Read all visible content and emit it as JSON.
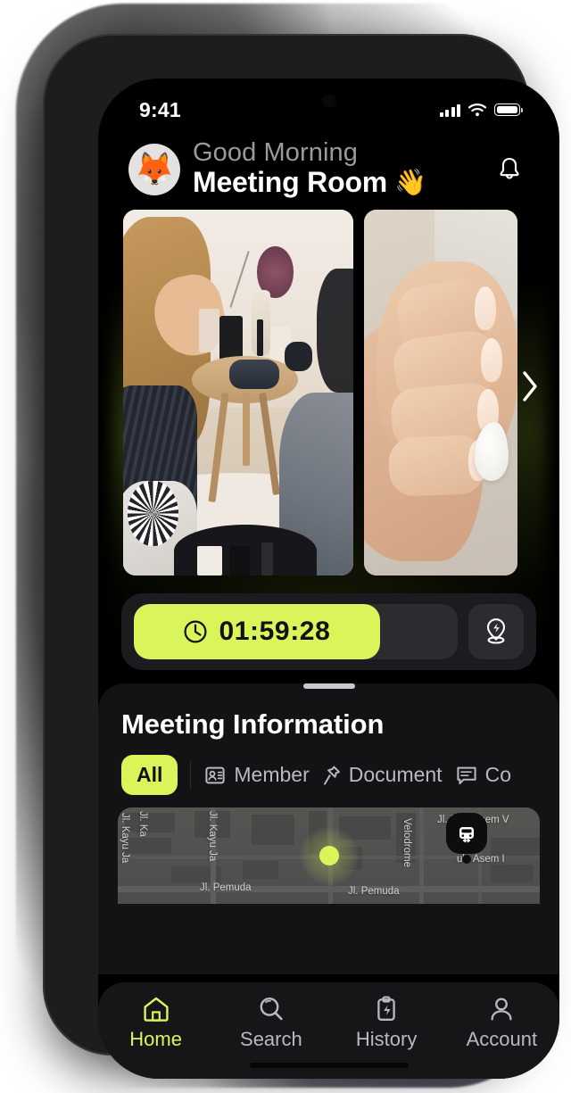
{
  "status_bar": {
    "time": "9:41",
    "signal_icon": "cellular-signal-icon",
    "wifi_icon": "wifi-icon",
    "battery_icon": "battery-icon"
  },
  "header": {
    "avatar_icon": "🦊",
    "greeting": "Good Morning",
    "title": "Meeting Room",
    "wave_emoji": "👋",
    "notification_icon": "bell-icon"
  },
  "carousel": {
    "next_arrow_icon": "chevron-right-icon",
    "slides": [
      {
        "alt": "meeting-room-table-photo"
      },
      {
        "alt": "hands-with-cream-photo"
      }
    ]
  },
  "timer": {
    "clock_icon": "clock-icon",
    "value": "01:59:28",
    "progress_percent": 76,
    "pin_button_icon": "location-pin-bolt-icon",
    "accent_color": "#d9f55a"
  },
  "sheet": {
    "grabber": "drag-handle",
    "title": "Meeting Information",
    "tabs": [
      {
        "label": "All",
        "icon": "",
        "active": true
      },
      {
        "label": "Member",
        "icon": "id-card-icon",
        "active": false
      },
      {
        "label": "Document",
        "icon": "pin-icon",
        "active": false
      },
      {
        "label": "Co",
        "icon": "comment-icon",
        "active": false
      }
    ]
  },
  "map": {
    "labels": [
      "Jl. Kayu Ja",
      "Jl. Ka",
      "Jl. Kayu Ja",
      "Jl. Pemuda",
      "Jl. Pemuda",
      "Velodrome",
      "Jl. Pulo Asem V",
      "ulo Asem I"
    ],
    "current_location_marker": "current-location-dot",
    "vehicle_pin_icon": "car-pin-icon"
  },
  "bottom_nav": {
    "items": [
      {
        "label": "Home",
        "icon": "home-icon",
        "active": true
      },
      {
        "label": "Search",
        "icon": "search-icon",
        "active": false
      },
      {
        "label": "History",
        "icon": "clipboard-bolt-icon",
        "active": false
      },
      {
        "label": "Account",
        "icon": "person-icon",
        "active": false
      }
    ],
    "active_color": "#d9f55a",
    "inactive_color": "#b9b9bf"
  }
}
